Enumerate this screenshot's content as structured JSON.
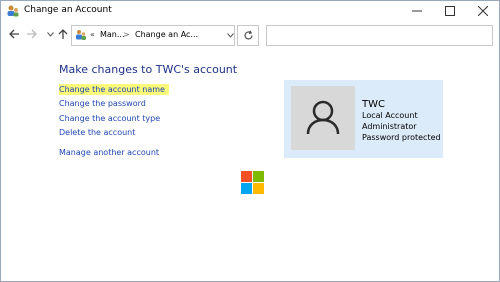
{
  "window": {
    "title": "Change an Account",
    "buttons": {
      "minimize_icon": "minimize-icon",
      "maximize_icon": "maximize-icon",
      "close_icon": "close-icon"
    }
  },
  "nav": {
    "breadcrumbs": [
      "«",
      "Man...",
      ">",
      "Change an Ac..."
    ],
    "search_placeholder": ""
  },
  "content": {
    "heading": "Make changes to TWC's account",
    "tasks": [
      "Change the account name",
      "Change the password",
      "Change the account type",
      "Delete the account"
    ],
    "manage_other": "Manage another account",
    "highlight_color": "#fbf97a",
    "link_color": "#1e46b4",
    "heading_color": "#1e3287"
  },
  "account": {
    "name": "TWC",
    "details": [
      "Local Account",
      "Administrator",
      "Password protected"
    ],
    "card_color": "#dcebf9"
  }
}
